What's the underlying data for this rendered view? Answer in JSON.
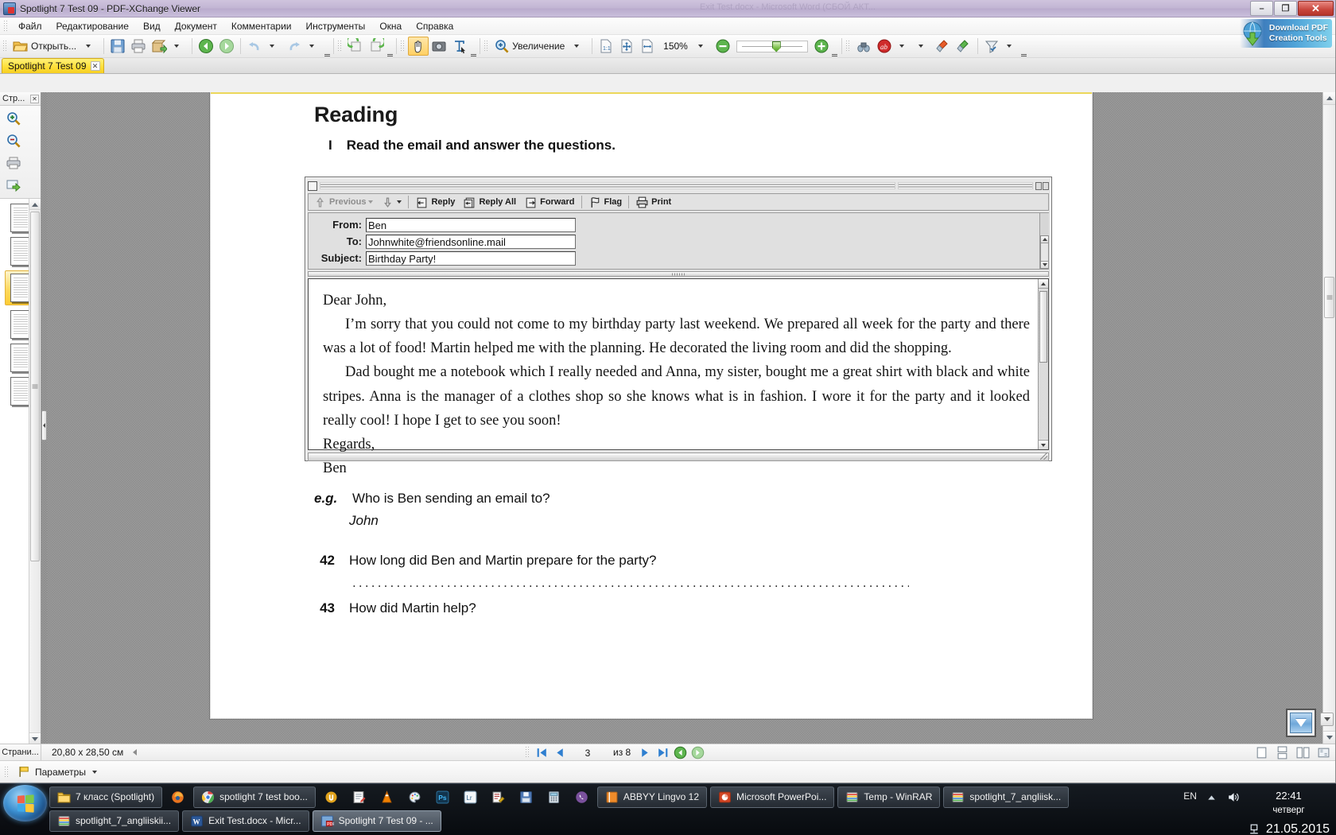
{
  "window": {
    "title": "Spotlight 7 Test 09 - PDF-XChange Viewer",
    "ghost_text": "Exit Test.docx - Microsoft Word (СБОЙ АКТ...",
    "minimize": "–",
    "maximize": "❐",
    "close": "✕"
  },
  "menu": {
    "items": [
      {
        "label": "Файл"
      },
      {
        "label": "Редактирование"
      },
      {
        "label": "Вид"
      },
      {
        "label": "Документ"
      },
      {
        "label": "Комментарии"
      },
      {
        "label": "Инструменты"
      },
      {
        "label": "Окна"
      },
      {
        "label": "Справка"
      }
    ]
  },
  "toolbar": {
    "open_label": "Открыть...",
    "zoom_label": "Увеличение",
    "zoom_value": "150%"
  },
  "promo": {
    "line1": "Download PDF",
    "line2": "Creation Tools"
  },
  "tabs": {
    "documents": [
      {
        "label": "Spotlight 7 Test 09",
        "close": "✕"
      }
    ]
  },
  "pages_panel": {
    "header": "Стр...",
    "close": "✕"
  },
  "document": {
    "title": "Reading",
    "task_number": "I",
    "task_text": "Read the email and answer the questions.",
    "email": {
      "toolbar": {
        "previous": "Previous",
        "reply": "Reply",
        "reply_all": "Reply All",
        "forward": "Forward",
        "flag": "Flag",
        "print": "Print"
      },
      "headers": [
        {
          "label": "From:",
          "value": "Ben"
        },
        {
          "label": "To:",
          "value": "Johnwhite@friendsonline.mail"
        },
        {
          "label": "Subject:",
          "value": "Birthday Party!"
        }
      ],
      "body": {
        "greeting": "Dear John,",
        "para1": "I’m sorry that you could not come to my birthday party last weekend. We prepared all week for the party and there was a lot of food! Martin helped me with the planning. He decorated the living room and did the shopping.",
        "para2": "Dad bought me a notebook which I really needed and Anna, my sister, bought me a great shirt with black and white stripes. Anna is the manager of a clothes shop so she knows what is in fashion. I wore it for the party and it looked really cool! I hope I get to see you soon!",
        "signoff": "Regards,",
        "signature": "Ben"
      }
    },
    "questions": [
      {
        "num": "e.g.",
        "text": "Who is Ben sending an email to?",
        "answer": "John"
      },
      {
        "num": "42",
        "text": "How long did Ben and Martin prepare for the party?",
        "answer": ""
      },
      {
        "num": "43",
        "text": "How did Martin help?",
        "answer": ""
      }
    ],
    "answer_dots": "................................................................................................"
  },
  "statusbar": {
    "pages_tab": "Страни...",
    "page_size": "20,80 x 28,50 см",
    "current_page": "3",
    "of_pages": "из 8"
  },
  "optionsbar": {
    "label": "Параметры"
  },
  "taskbar": {
    "row_top": [
      {
        "label": "7 класс (Spotlight)",
        "icon": "folder-icon",
        "style": "button",
        "active": false
      },
      {
        "label": "",
        "icon": "firefox-icon",
        "style": "plain",
        "active": false
      },
      {
        "label": "spotlight 7 test boo...",
        "icon": "chrome-icon",
        "style": "button",
        "active": false
      },
      {
        "label": "",
        "icon": "utorrent-icon",
        "style": "plain",
        "active": false
      },
      {
        "label": "",
        "icon": "notepad-icon",
        "style": "plain",
        "active": false
      },
      {
        "label": "",
        "icon": "vlc-icon",
        "style": "plain",
        "active": false
      },
      {
        "label": "",
        "icon": "paint-icon",
        "style": "plain",
        "active": false
      },
      {
        "label": "",
        "icon": "photoshop-icon",
        "style": "plain",
        "active": false
      },
      {
        "label": "",
        "icon": "lightroom-icon",
        "style": "plain",
        "active": false
      },
      {
        "label": "",
        "icon": "editor-icon",
        "style": "plain",
        "active": false
      },
      {
        "label": "",
        "icon": "save-disk-icon",
        "style": "plain",
        "active": false
      },
      {
        "label": "",
        "icon": "calculator-icon",
        "style": "plain",
        "active": false
      },
      {
        "label": "",
        "icon": "viber-icon",
        "style": "plain",
        "active": false
      },
      {
        "label": "ABBYY Lingvo 12",
        "icon": "lingvo-icon",
        "style": "button",
        "active": false
      },
      {
        "label": "Microsoft PowerPoi...",
        "icon": "powerpoint-icon",
        "style": "button",
        "active": false
      },
      {
        "label": "Temp - WinRAR",
        "icon": "winrar-icon",
        "style": "button",
        "active": false
      },
      {
        "label": "spotlight_7_angliisk...",
        "icon": "winrar-icon",
        "style": "button",
        "active": false
      }
    ],
    "row_bottom": [
      {
        "label": "spotlight_7_angliiskii...",
        "icon": "winrar-icon",
        "style": "button",
        "active": false
      },
      {
        "label": "Exit Test.docx - Micr...",
        "icon": "word-icon",
        "style": "button",
        "active": false
      },
      {
        "label": "Spotlight 7 Test 09 - ...",
        "icon": "pdfx-icon",
        "style": "button",
        "active": true
      }
    ],
    "tray": {
      "language": "EN",
      "time": "22:41",
      "day": "четверг",
      "date": "21.05.2015"
    }
  }
}
